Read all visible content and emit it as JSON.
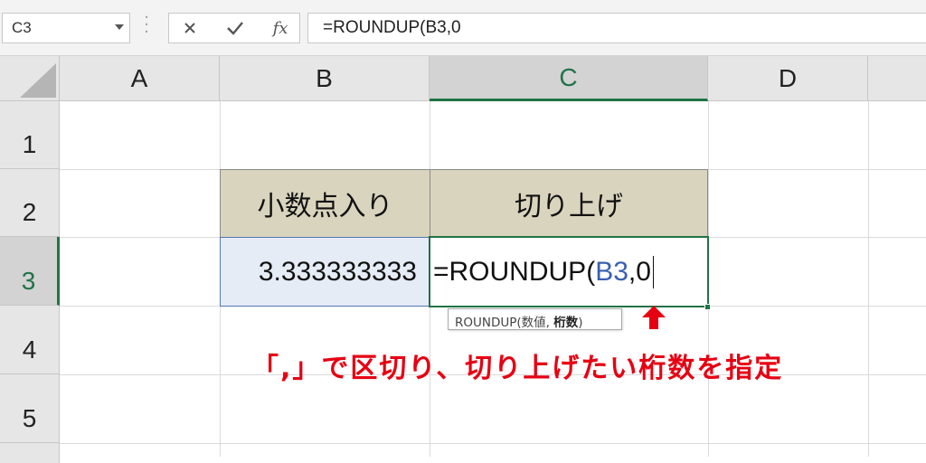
{
  "formula_bar": {
    "name_box": "C3",
    "cancel_icon": "×",
    "enter_icon": "✓",
    "fx_label": "fx",
    "formula": "=ROUNDUP(B3,0"
  },
  "columns": [
    "A",
    "B",
    "C",
    "D"
  ],
  "rows": [
    "1",
    "2",
    "3",
    "4",
    "5"
  ],
  "selected": {
    "column": "C",
    "row": "3"
  },
  "cells": {
    "B2": "小数点入り",
    "C2": "切り上げ",
    "B3": "3.333333333",
    "C3_prefix": "=ROUNDUP(",
    "C3_ref": "B3",
    "C3_suffix": ",0"
  },
  "tooltip": {
    "text": "ROUNDUP(数値, ",
    "bold_arg": "桁数",
    "close": ")"
  },
  "annotation": {
    "text": "「,」で区切り、切り上げたい桁数を指定",
    "arrow_icon": "up-arrow-icon"
  },
  "colors": {
    "header_fill": "#d9d4bd",
    "selection": "#217346",
    "reference_blue": "#3b5fb0",
    "annotation_red": "#e60012"
  }
}
